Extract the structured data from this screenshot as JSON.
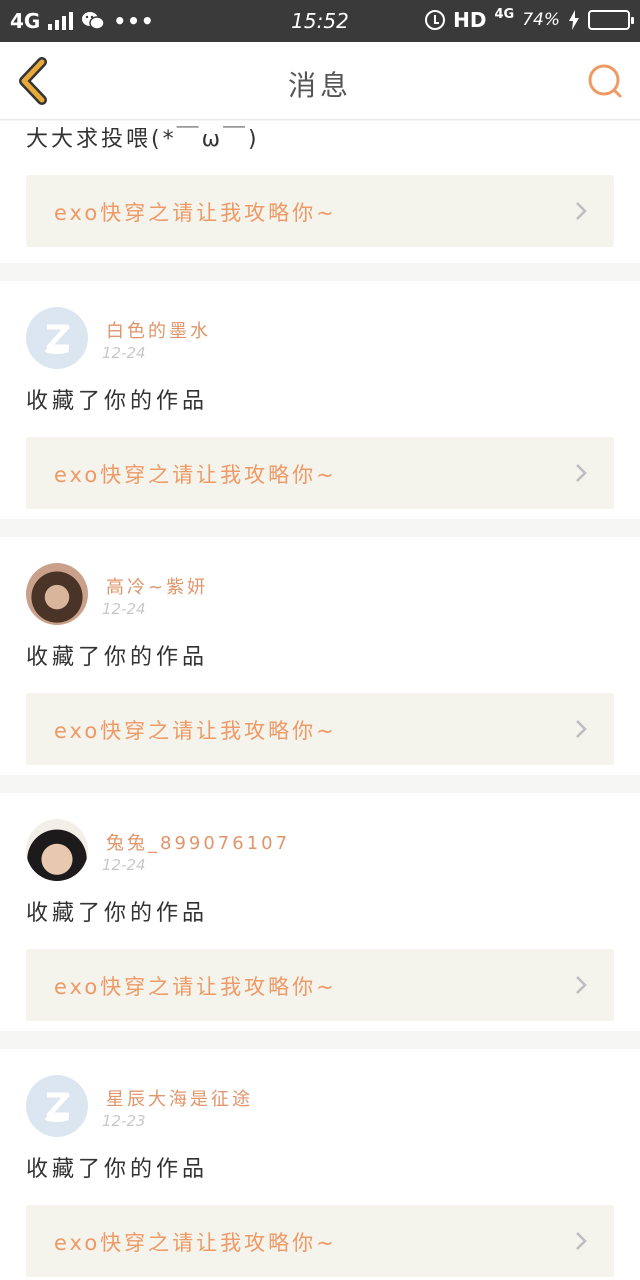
{
  "status_bar": {
    "network": "4G",
    "time": "15:52",
    "hd": "HD",
    "net_type": "4G",
    "battery_percent": "74%",
    "battery_level": 0.74
  },
  "header": {
    "title": "消息"
  },
  "top_card": {
    "message": "大大求投喂(*￣ω￣)",
    "work_title": "exo快穿之请让我攻略你~"
  },
  "notifications": [
    {
      "username": "白色的墨水",
      "date": "12-24",
      "action": "收藏了你的作品",
      "work_title": "exo快穿之请让我攻略你~"
    },
    {
      "username": "高冷~紫妍",
      "date": "12-24",
      "action": "收藏了你的作品",
      "work_title": "exo快穿之请让我攻略你~"
    },
    {
      "username": "兔兔_899076107",
      "date": "12-24",
      "action": "收藏了你的作品",
      "work_title": "exo快穿之请让我攻略你~"
    },
    {
      "username": "星辰大海是征途",
      "date": "12-23",
      "action": "收藏了你的作品",
      "work_title": "exo快穿之请让我攻略你~"
    }
  ],
  "colors": {
    "accent": "#ee9a66",
    "back_arrow": "#e8a93a",
    "card_link_bg": "#f4f3ec"
  }
}
